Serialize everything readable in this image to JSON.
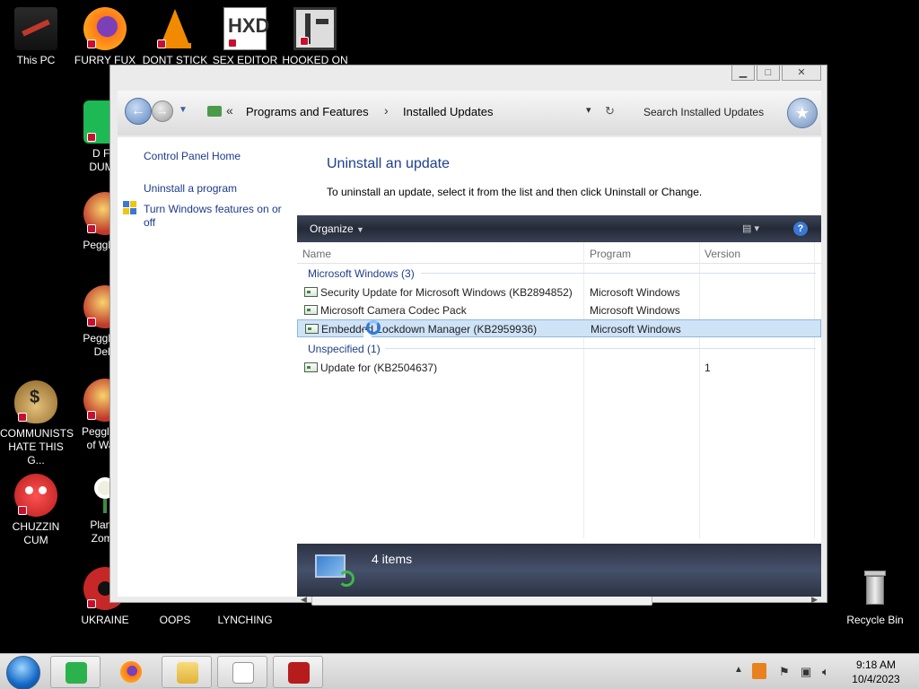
{
  "desktop_icons": [
    {
      "label": "This PC",
      "color": "#333333"
    },
    {
      "label": "FURRY FUX",
      "color": "#e8661f"
    },
    {
      "label": "DONT STICK",
      "color": "#f18a00"
    },
    {
      "label": "SEX EDITOR",
      "color": "#b6a27a"
    },
    {
      "label": "HOOKED ON",
      "color": "#444444"
    },
    {
      "label": "D FC\nDUMB",
      "color": "#1db954"
    },
    {
      "label": "Peggle D",
      "color": "#c0392b"
    },
    {
      "label": "Peggle N\nDelu",
      "color": "#c0392b"
    },
    {
      "label": "COMMUNISTS\nHATE THIS G...",
      "color": "#b8860b"
    },
    {
      "label": "Peggle W\nof Warc",
      "color": "#c0392b"
    },
    {
      "label": "CHUZZIN\nCUM",
      "color": "#d32f2f"
    },
    {
      "label": "Plants\nZomb",
      "color": "#e8e8d0"
    },
    {
      "label": "UKRAINE",
      "color": "#c62828"
    },
    {
      "label": "OOPS",
      "color": "#555555"
    },
    {
      "label": "LYNCHING",
      "color": "#555555"
    },
    {
      "label": "Recycle Bin",
      "color": "#d8d8d8"
    }
  ],
  "window": {
    "title_buttons": {
      "minimize": "▁",
      "maximize": "□",
      "close": "✕"
    },
    "breadcrumb": {
      "root_chevrons": "«",
      "items": [
        "Programs and Features",
        "Installed Updates"
      ],
      "separator": "›"
    },
    "search": {
      "placeholder": "Search Installed Updates"
    },
    "left_pane": {
      "home_link": "Control Panel Home",
      "uninstall_link": "Uninstall a program",
      "features_link": "Turn Windows features on or off"
    },
    "main": {
      "title": "Uninstall an update",
      "description": "To uninstall an update, select it from the list and then click Uninstall or Change."
    },
    "toolbar": {
      "organize": "Organize",
      "help": "?"
    },
    "columns": [
      "Name",
      "Program",
      "Version"
    ],
    "groups": [
      {
        "name": "Microsoft Windows (3)",
        "rows": [
          {
            "name": "Security Update for Microsoft Windows (KB2894852)",
            "program": "Microsoft Windows",
            "version": ""
          },
          {
            "name": "Microsoft Camera Codec Pack",
            "program": "Microsoft Windows",
            "version": ""
          },
          {
            "name": "Embedded Lockdown Manager (KB2959936)",
            "program": "Microsoft Windows",
            "version": "",
            "selected": true
          }
        ]
      },
      {
        "name": "Unspecified (1)",
        "rows": [
          {
            "name": "Update for  (KB2504637)",
            "program": "",
            "version": "1"
          }
        ]
      }
    ],
    "details": {
      "item_count": "4 items"
    }
  },
  "taskbar": {
    "clock_time": "9:18 AM",
    "clock_date": "10/4/2023",
    "apps": [
      {
        "name": "feedly",
        "color": "#2bb24c"
      },
      {
        "name": "firefox",
        "color": "#e66000"
      },
      {
        "name": "file-explorer",
        "color": "#e8c45a"
      },
      {
        "name": "app-4",
        "color": "#ffffff"
      },
      {
        "name": "app-5",
        "color": "#b71c1c"
      }
    ]
  }
}
